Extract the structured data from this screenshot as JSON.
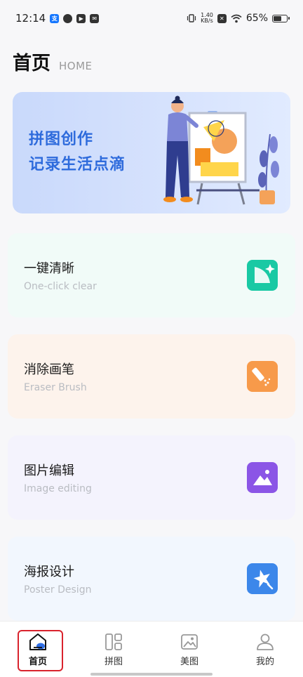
{
  "status_bar": {
    "time": "12:14",
    "net_speed_value": "1.40",
    "net_speed_unit": "KB/s",
    "battery": "65%",
    "battery_level": 0.65
  },
  "header": {
    "title": "首页",
    "subtitle": "HOME"
  },
  "banner": {
    "line1": "拼图创作",
    "line2": "记录生活点滴"
  },
  "features": [
    {
      "title": "一键清晰",
      "subtitle": "One-click clear",
      "icon": "sparkle-icon",
      "bg": "#f1fbf8",
      "icon_color": "#19c9a4"
    },
    {
      "title": "消除画笔",
      "subtitle": "Eraser Brush",
      "icon": "eraser-brush-icon",
      "bg": "#fdf3ec",
      "icon_color": "#f79a4a"
    },
    {
      "title": "图片编辑",
      "subtitle": "Image editing",
      "icon": "image-edit-icon",
      "bg": "#f4f3fd",
      "icon_color": "#8b55e6"
    },
    {
      "title": "海报设计",
      "subtitle": "Poster Design",
      "icon": "poster-star-icon",
      "bg": "#f2f7fe",
      "icon_color": "#3c87ea"
    }
  ],
  "nav": {
    "items": [
      {
        "label": "首页",
        "icon": "home-icon",
        "active": true
      },
      {
        "label": "拼图",
        "icon": "collage-icon",
        "active": false
      },
      {
        "label": "美图",
        "icon": "gallery-icon",
        "active": false
      },
      {
        "label": "我的",
        "icon": "profile-icon",
        "active": false
      }
    ]
  },
  "colors": {
    "accent": "#2e6bdc",
    "highlight": "#d9232d"
  }
}
